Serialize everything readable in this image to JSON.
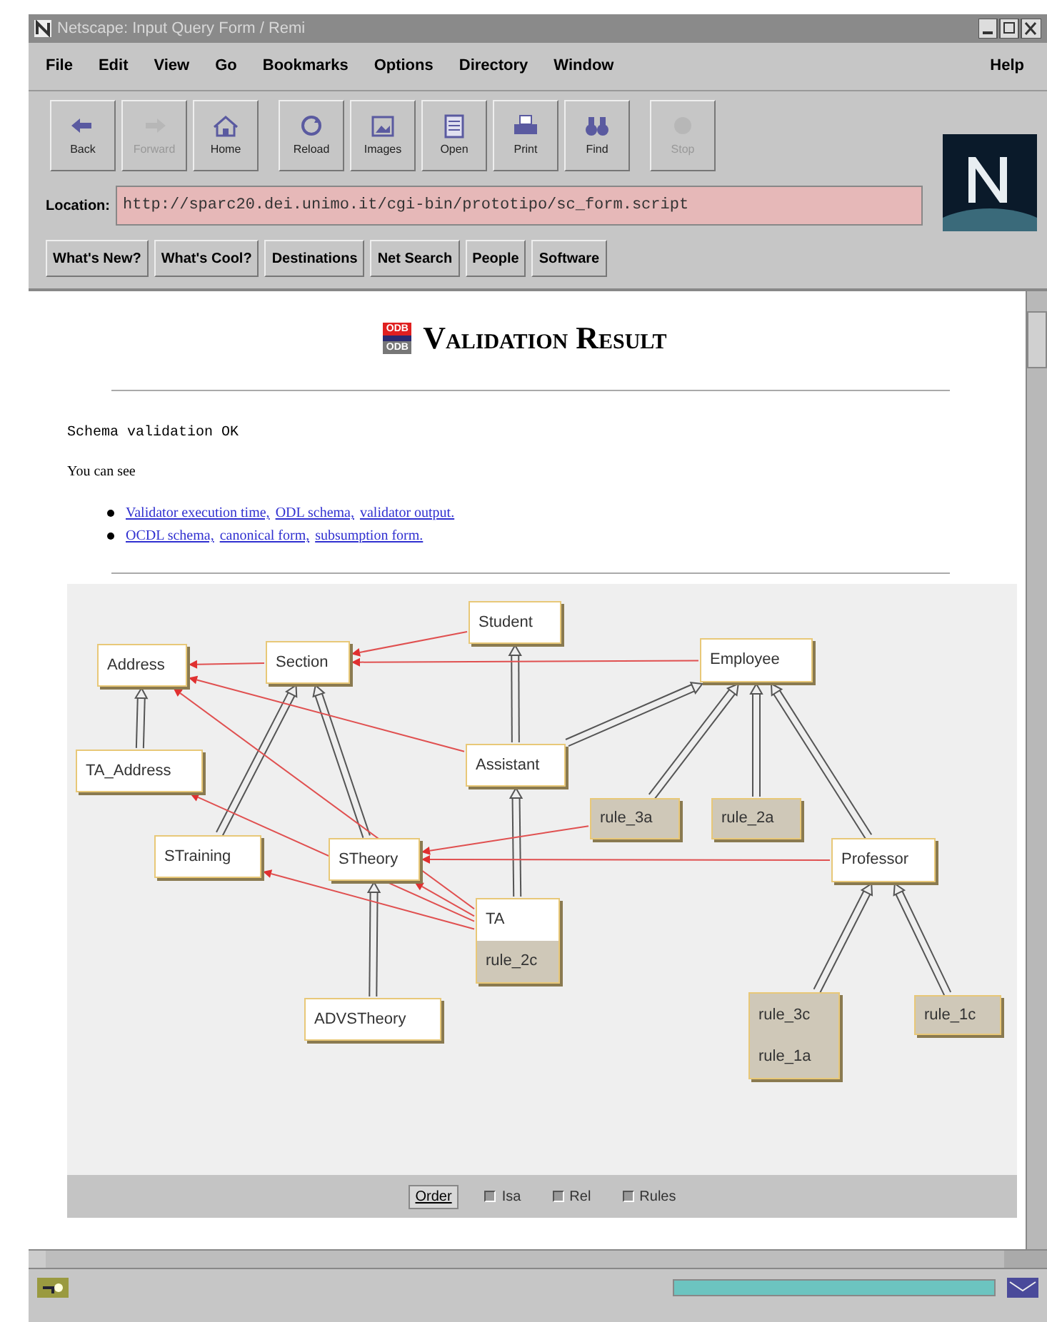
{
  "window": {
    "title": "Netscape: Input Query Form / Remi"
  },
  "menu": [
    {
      "label": "File"
    },
    {
      "label": "Edit"
    },
    {
      "label": "View"
    },
    {
      "label": "Go"
    },
    {
      "label": "Bookmarks"
    },
    {
      "label": "Options"
    },
    {
      "label": "Directory"
    },
    {
      "label": "Window"
    }
  ],
  "help_menu": {
    "label": "Help"
  },
  "toolbar": [
    {
      "label": "Back",
      "kind": "back",
      "disabled": false
    },
    {
      "label": "Forward",
      "kind": "forward",
      "disabled": true
    },
    {
      "label": "Home",
      "kind": "home",
      "disabled": false
    },
    {
      "label": "Reload",
      "kind": "reload",
      "disabled": false
    },
    {
      "label": "Images",
      "kind": "images",
      "disabled": false
    },
    {
      "label": "Open",
      "kind": "open",
      "disabled": false
    },
    {
      "label": "Print",
      "kind": "print",
      "disabled": false
    },
    {
      "label": "Find",
      "kind": "find",
      "disabled": false
    },
    {
      "label": "Stop",
      "kind": "stop",
      "disabled": true
    }
  ],
  "location": {
    "label": "Location:",
    "value": "http://sparc20.dei.unimo.it/cgi-bin/prototipo/sc_form.script"
  },
  "directory_buttons": [
    {
      "label": "What's New?"
    },
    {
      "label": "What's Cool?"
    },
    {
      "label": "Destinations"
    },
    {
      "label": "Net Search"
    },
    {
      "label": "People"
    },
    {
      "label": "Software"
    }
  ],
  "page": {
    "logo_top": "ODB",
    "logo_bottom": "ODB",
    "title": "Validation Result",
    "status": "Schema validation OK",
    "intro": "You can see",
    "link_lines": [
      [
        "Validator execution time,",
        "ODL schema,",
        "validator output."
      ],
      [
        "OCDL schema,",
        "canonical form,",
        "subsumption form."
      ]
    ]
  },
  "diagram": {
    "nodes": [
      {
        "rows": [
          {
            "text": "Student",
            "kind": "class"
          }
        ]
      },
      {
        "rows": [
          {
            "text": "Address",
            "kind": "class"
          }
        ]
      },
      {
        "rows": [
          {
            "text": "Section",
            "kind": "class"
          }
        ]
      },
      {
        "rows": [
          {
            "text": "Employee",
            "kind": "class"
          }
        ]
      },
      {
        "rows": [
          {
            "text": "TA_Address",
            "kind": "class"
          }
        ]
      },
      {
        "rows": [
          {
            "text": "Assistant",
            "kind": "class"
          }
        ]
      },
      {
        "rows": [
          {
            "text": "rule_3a",
            "kind": "rule"
          }
        ]
      },
      {
        "rows": [
          {
            "text": "rule_2a",
            "kind": "rule"
          }
        ]
      },
      {
        "rows": [
          {
            "text": "STraining",
            "kind": "class"
          }
        ]
      },
      {
        "rows": [
          {
            "text": "STheory",
            "kind": "class"
          }
        ]
      },
      {
        "rows": [
          {
            "text": "Professor",
            "kind": "class"
          }
        ]
      },
      {
        "rows": [
          {
            "text": "TA",
            "kind": "class"
          },
          {
            "text": "rule_2c",
            "kind": "rule"
          }
        ]
      },
      {
        "rows": [
          {
            "text": "ADVSTheory",
            "kind": "class"
          }
        ]
      },
      {
        "rows": [
          {
            "text": "rule_3c",
            "kind": "rule"
          },
          {
            "text": "rule_1a",
            "kind": "rule"
          }
        ]
      },
      {
        "rows": [
          {
            "text": "rule_1c",
            "kind": "rule"
          }
        ]
      }
    ],
    "order_button": {
      "label": "Order"
    },
    "toggles": [
      {
        "label": "Isa",
        "checked": true
      },
      {
        "label": "Rel",
        "checked": true
      },
      {
        "label": "Rules",
        "checked": true
      }
    ]
  },
  "status_bar": {
    "progress": {
      "level": 1
    }
  }
}
